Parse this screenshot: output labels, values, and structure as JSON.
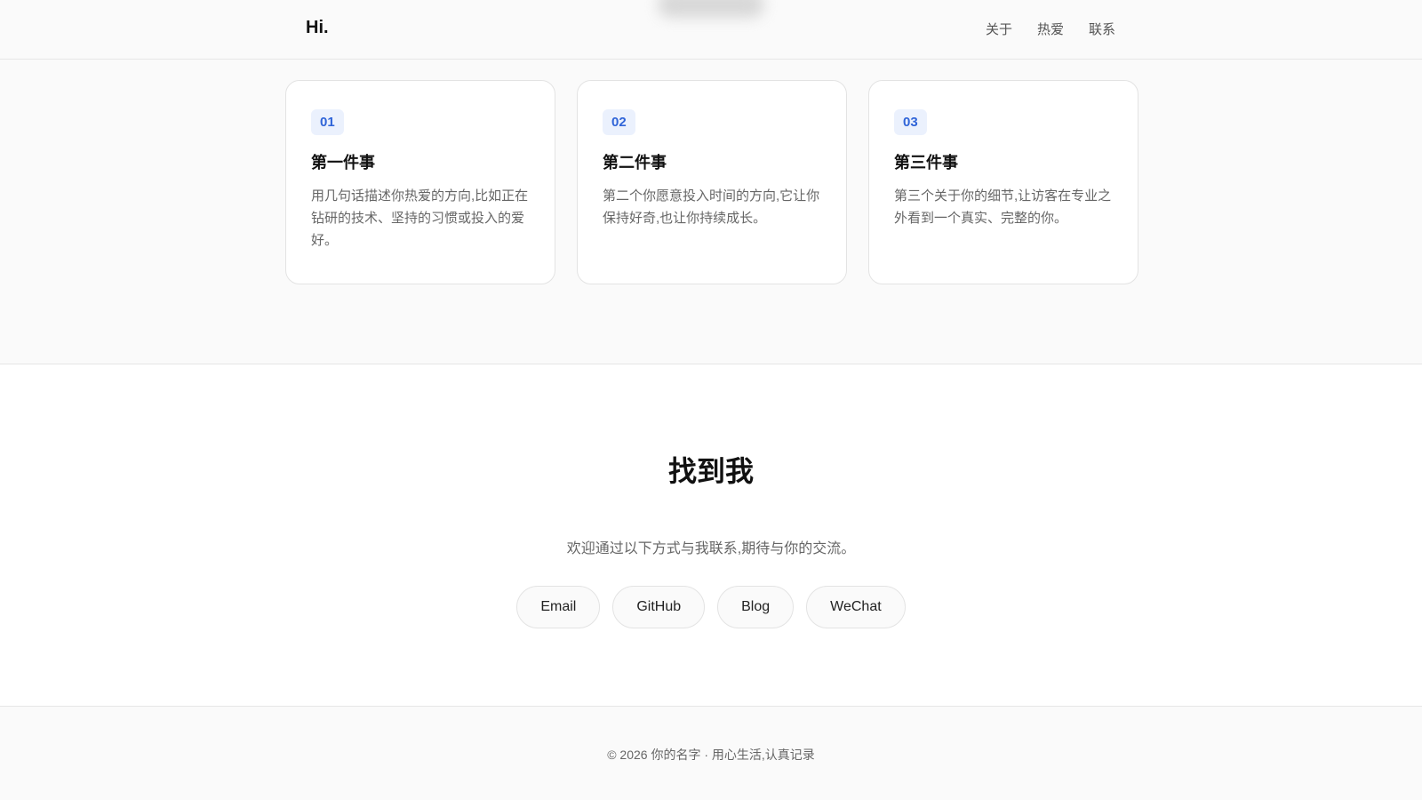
{
  "nav": {
    "logo": "Hi.",
    "links": [
      "关于",
      "热爱",
      "联系"
    ]
  },
  "cards": [
    {
      "num": "01",
      "title": "第一件事",
      "desc": "用几句话描述你热爱的方向,比如正在钻研的技术、坚持的习惯或投入的爱好。"
    },
    {
      "num": "02",
      "title": "第二件事",
      "desc": "第二个你愿意投入时间的方向,它让你保持好奇,也让你持续成长。"
    },
    {
      "num": "03",
      "title": "第三件事",
      "desc": "第三个关于你的细节,让访客在专业之外看到一个真实、完整的你。"
    }
  ],
  "contact": {
    "heading": "找到我",
    "subtitle": "欢迎通过以下方式与我联系,期待与你的交流。",
    "buttons": [
      "Email",
      "GitHub",
      "Blog",
      "WeChat"
    ]
  },
  "footer": {
    "text": "© 2026 你的名字 · 用心生活,认真记录"
  },
  "colors": {
    "accent": "#2f64d8",
    "accent_bg": "#ebf1fd",
    "page_bg": "#fafafa"
  }
}
